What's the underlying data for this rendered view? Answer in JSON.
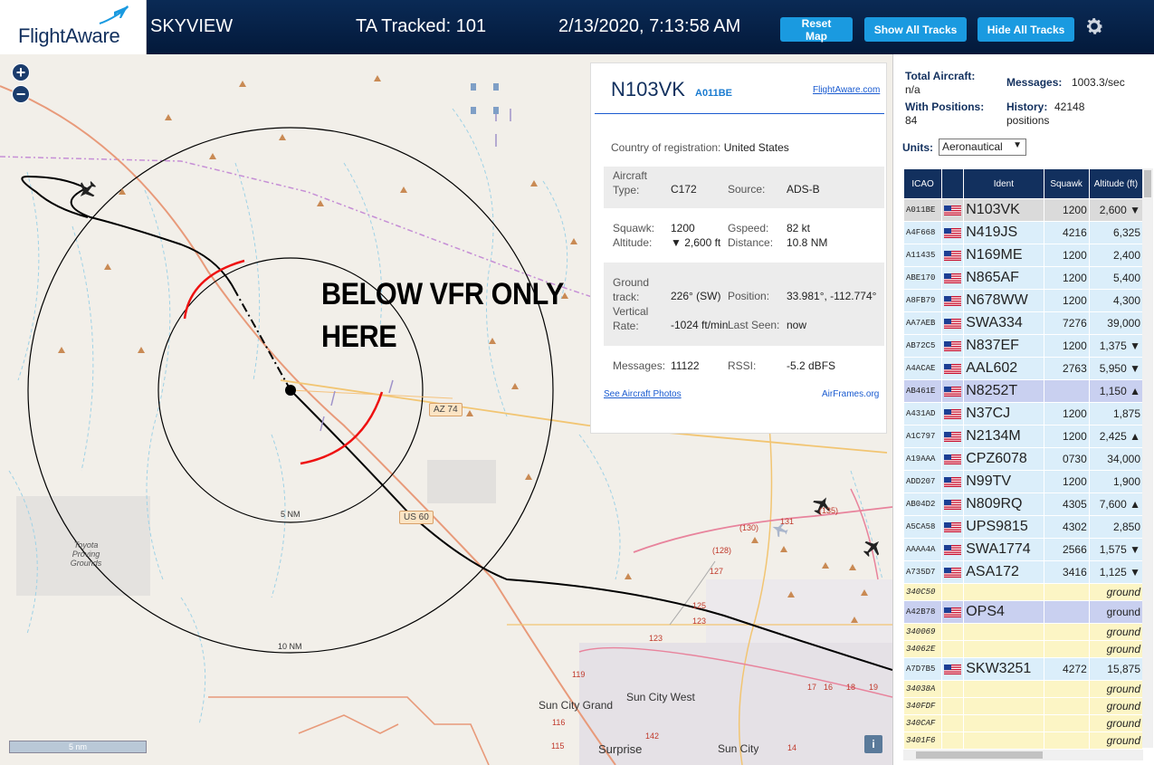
{
  "header": {
    "logo": "FlightAware",
    "site_name": "SKYVIEW",
    "tracked": "TA Tracked: 101",
    "datetime": "2/13/2020, 7:13:58 AM",
    "buttons": {
      "reset_map": "Reset Map",
      "show_all": "Show All Tracks",
      "hide_all": "Hide All Tracks"
    },
    "icons": {
      "logo": "plane-logo-icon",
      "settings": "gear-icon"
    }
  },
  "map": {
    "zoom_in": "+",
    "zoom_out": "−",
    "annotation_line1": "BELOW VFR ONLY",
    "annotation_line2": "HERE",
    "ring_labels": [
      "5 NM",
      "10 NM"
    ],
    "roads": [
      "AZ 74",
      "US 60"
    ],
    "road_numbers": [
      "(130)",
      "131",
      "(135)",
      "(128)",
      "127",
      "125",
      "123",
      "119",
      "116",
      "115",
      "142",
      "17",
      "16",
      "18",
      "19",
      "14",
      "123"
    ],
    "places": [
      "Toyota Proving Grounds",
      "Sun City Grand",
      "Sun City West",
      "Surprise",
      "Sun City"
    ],
    "scale": "5 nm",
    "info": "i",
    "colors": {
      "track": "#000000",
      "annotation": "#e11",
      "land": "#f2efe9"
    }
  },
  "popup": {
    "ident": "N103VK",
    "icao": "A011BE",
    "fa_link": "FlightAware.com",
    "registration_label": "Country of registration:",
    "registration": "United States",
    "aircraft_type_label": "Aircraft Type:",
    "aircraft_type": "C172",
    "source_label": "Source:",
    "source": "ADS-B",
    "squawk_label": "Squawk:",
    "squawk": "1200",
    "gspeed_label": "Gspeed:",
    "gspeed": "82 kt",
    "altitude_label": "Altitude:",
    "altitude": "▼ 2,600 ft",
    "distance_label": "Distance:",
    "distance": "10.8 NM",
    "track_label": "Ground track:",
    "track": "226° (SW)",
    "position_label": "Position:",
    "position": "33.981°, -112.774°",
    "vrate_label": "Vertical Rate:",
    "vrate": "-1024 ft/min",
    "lastseen_label": "Last Seen:",
    "lastseen": "now",
    "messages_label": "Messages:",
    "messages": "11122",
    "rssi_label": "RSSI:",
    "rssi": "-5.2 dBFS",
    "photos_link": "See Aircraft Photos",
    "airframes_link": "AirFrames.org"
  },
  "sidebar": {
    "total_label": "Total Aircraft:",
    "total": "n/a",
    "messages_label": "Messages:",
    "messages": "1003.3/sec",
    "positions_label": "With Positions:",
    "positions": "84",
    "history_label": "History:",
    "history": "42148 positions",
    "units_label": "Units:",
    "units": "Aeronautical",
    "columns": [
      "ICAO",
      "",
      "Ident",
      "Squawk",
      "Altitude (ft)"
    ],
    "rows": [
      {
        "icao": "A011BE",
        "flag": true,
        "ident": "N103VK",
        "squawk": "1200",
        "alt": "2,600 ▼",
        "style": "sel"
      },
      {
        "icao": "A4F668",
        "flag": true,
        "ident": "N419JS",
        "squawk": "4216",
        "alt": "6,325",
        "style": "blue"
      },
      {
        "icao": "A11435",
        "flag": true,
        "ident": "N169ME",
        "squawk": "1200",
        "alt": "2,400",
        "style": "blue"
      },
      {
        "icao": "ABE170",
        "flag": true,
        "ident": "N865AF",
        "squawk": "1200",
        "alt": "5,400",
        "style": "blue"
      },
      {
        "icao": "A8FB79",
        "flag": true,
        "ident": "N678WW",
        "squawk": "1200",
        "alt": "4,300",
        "style": "blue"
      },
      {
        "icao": "AA7AEB",
        "flag": true,
        "ident": "SWA334",
        "squawk": "7276",
        "alt": "39,000",
        "style": "blue"
      },
      {
        "icao": "AB72C5",
        "flag": true,
        "ident": "N837EF",
        "squawk": "1200",
        "alt": "1,375 ▼",
        "style": "blue"
      },
      {
        "icao": "A4ACAE",
        "flag": true,
        "ident": "AAL602",
        "squawk": "2763",
        "alt": "5,950 ▼",
        "style": "blue"
      },
      {
        "icao": "AB461E",
        "flag": true,
        "ident": "N8252T",
        "squawk": "",
        "alt": "1,150 ▲",
        "style": "hl"
      },
      {
        "icao": "A431AD",
        "flag": true,
        "ident": "N37CJ",
        "squawk": "1200",
        "alt": "1,875",
        "style": "blue"
      },
      {
        "icao": "A1C797",
        "flag": true,
        "ident": "N2134M",
        "squawk": "1200",
        "alt": "2,425 ▲",
        "style": "blue"
      },
      {
        "icao": "A19AAA",
        "flag": true,
        "ident": "CPZ6078",
        "squawk": "0730",
        "alt": "34,000",
        "style": "blue"
      },
      {
        "icao": "ADD207",
        "flag": true,
        "ident": "N99TV",
        "squawk": "1200",
        "alt": "1,900",
        "style": "blue"
      },
      {
        "icao": "AB04D2",
        "flag": true,
        "ident": "N809RQ",
        "squawk": "4305",
        "alt": "7,600 ▲",
        "style": "blue"
      },
      {
        "icao": "A5CA58",
        "flag": true,
        "ident": "UPS9815",
        "squawk": "4302",
        "alt": "2,850",
        "style": "blue"
      },
      {
        "icao": "AAAA4A",
        "flag": true,
        "ident": "SWA1774",
        "squawk": "2566",
        "alt": "1,575 ▼",
        "style": "blue"
      },
      {
        "icao": "A735D7",
        "flag": true,
        "ident": "ASA172",
        "squawk": "3416",
        "alt": "1,125 ▼",
        "style": "blue"
      },
      {
        "icao": "340C50",
        "flag": false,
        "ident": "",
        "squawk": "",
        "alt": "ground",
        "style": "yel"
      },
      {
        "icao": "A42B78",
        "flag": true,
        "ident": "OPS4",
        "squawk": "",
        "alt": "ground",
        "style": "hl"
      },
      {
        "icao": "340069",
        "flag": false,
        "ident": "",
        "squawk": "",
        "alt": "ground",
        "style": "yel"
      },
      {
        "icao": "34062E",
        "flag": false,
        "ident": "",
        "squawk": "",
        "alt": "ground",
        "style": "yel"
      },
      {
        "icao": "A7D7B5",
        "flag": true,
        "ident": "SKW3251",
        "squawk": "4272",
        "alt": "15,875",
        "style": "blue"
      },
      {
        "icao": "34038A",
        "flag": false,
        "ident": "",
        "squawk": "",
        "alt": "ground",
        "style": "yel"
      },
      {
        "icao": "340FDF",
        "flag": false,
        "ident": "",
        "squawk": "",
        "alt": "ground",
        "style": "yel"
      },
      {
        "icao": "340CAF",
        "flag": false,
        "ident": "",
        "squawk": "",
        "alt": "ground",
        "style": "yel"
      },
      {
        "icao": "3401F6",
        "flag": false,
        "ident": "",
        "squawk": "",
        "alt": "ground",
        "style": "yel"
      }
    ]
  }
}
